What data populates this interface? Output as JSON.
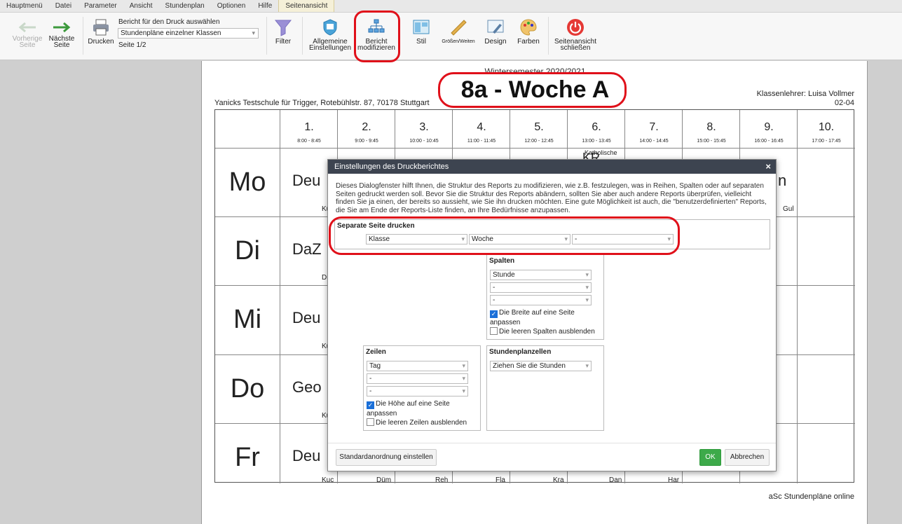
{
  "menu": [
    "Hauptmenü",
    "Datei",
    "Parameter",
    "Ansicht",
    "Stundenplan",
    "Optionen",
    "Hilfe",
    "Seitenansicht"
  ],
  "toolbar": {
    "prev_l1": "Vorherige",
    "prev_l2": "Seite",
    "next_l1": "Nächste",
    "next_l2": "Seite",
    "print": "Drucken",
    "report_label": "Bericht für den Druck auswählen",
    "report_value": "Stundenpläne einzelner Klassen",
    "page_info": "Seite 1/2",
    "filter": "Filter",
    "general_l1": "Allgemeine",
    "general_l2": "Einstellungen",
    "modify_l1": "Bericht",
    "modify_l2": "modifizieren",
    "style": "Stil",
    "sizes": "Größen/Weiten",
    "design": "Design",
    "colors": "Farben",
    "close_l1": "Seitenansicht",
    "close_l2": "schließen",
    "close_color": "#e53935"
  },
  "page": {
    "semester": "Wintersemester 2020/2021",
    "title": "8a - Woche A",
    "school": "Yanicks Testschule für Trigger, Rotebühlstr. 87, 70178 Stuttgart",
    "teacher_l1": "Klassenlehrer: Luisa Vollmer",
    "teacher_l2": "02-04",
    "footer": "aSc Stundenpläne online"
  },
  "periods": [
    {
      "n": "1.",
      "t": "8:00 - 8:45"
    },
    {
      "n": "2.",
      "t": "9:00 - 9:45"
    },
    {
      "n": "3.",
      "t": "10:00 - 10:45"
    },
    {
      "n": "4.",
      "t": "11:00 - 11:45"
    },
    {
      "n": "5.",
      "t": "12:00 - 12:45"
    },
    {
      "n": "6.",
      "t": "13:00 - 13:45"
    },
    {
      "n": "7.",
      "t": "14:00 - 14:45"
    },
    {
      "n": "8.",
      "t": "15:00 - 15:45"
    },
    {
      "n": "9.",
      "t": "16:00 - 16:45"
    },
    {
      "n": "10.",
      "t": "17:00 - 17:45"
    }
  ],
  "days": [
    "Mo",
    "Di",
    "Mi",
    "Do",
    "Fr"
  ],
  "cells": {
    "mo_subj": "Deu",
    "mo_tch": "Ku",
    "mo_extra1": "Katholische",
    "mo_extra2": "KR",
    "mo_right": "n",
    "mo_right_tch": "Gul",
    "di_subj": "DaZ",
    "di_tch": "Dü",
    "mi_subj": "Deu",
    "mi_tch": "Ku",
    "do_subj": "Geo",
    "do_tch": "Ku",
    "fr_subj": "Deu",
    "fr_tch": [
      "Kuc",
      "Düm",
      "Reh",
      "Fla",
      "Kra",
      "Dan",
      "Har"
    ]
  },
  "dialog": {
    "title": "Einstellungen des Druckberichtes",
    "close": "×",
    "desc": "Dieses Dialogfenster hilft Ihnen, die Struktur des Reports zu modifizieren, wie z.B. festzulegen, was in Reihen, Spalten oder auf separaten Seiten gedruckt werden soll. Bevor Sie die Struktur des Reports abändern, sollten Sie aber auch andere Reports überprüfen, vielleicht finden Sie ja einen, der bereits so aussieht, wie Sie ihn drucken möchten. Eine gute Möglichkeit ist auch, die \"benutzerdefinierten\" Reports, die Sie am Ende der Reports-Liste finden, an Ihre Bedürfnisse anzupassen.",
    "separate_label": "Separate Seite drucken",
    "sep_sel": [
      "Klasse",
      "Woche",
      "-"
    ],
    "cols_label": "Spalten",
    "cols_sel": [
      "Stunde",
      "-",
      "-"
    ],
    "cols_fit_l1": "Die Breite auf eine Seite",
    "cols_fit_l2": "anpassen",
    "cols_hide": "Die leeren Spalten ausblenden",
    "rows_label": "Zeilen",
    "rows_sel": [
      "Tag",
      "-",
      "-"
    ],
    "rows_fit_l1": "Die Höhe auf eine Seite",
    "rows_fit_l2": "anpassen",
    "rows_hide": "Die leeren Zeilen ausblenden",
    "cells_label": "Stundenplanzellen",
    "cells_sel": "Ziehen Sie die Stunden",
    "btn_default": "Standardanordnung einstellen",
    "btn_ok": "OK",
    "btn_cancel": "Abbrechen"
  }
}
